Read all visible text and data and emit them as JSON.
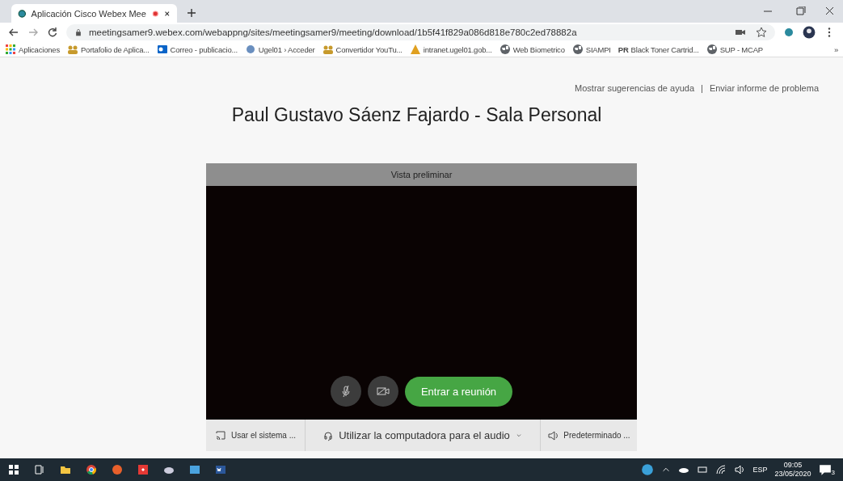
{
  "browser": {
    "tab": {
      "title": "Aplicación Cisco Webex Mee",
      "selected": true
    },
    "url": "meetingsamer9.webex.com/webappng/sites/meetingsamer9/meeting/download/1b5f41f829a086d818e780c2ed78882a",
    "bookmarks": [
      {
        "label": "Aplicaciones",
        "kind": "apps"
      },
      {
        "label": "Portafolio de Aplica...",
        "kind": "people"
      },
      {
        "label": "Correo - publicacio...",
        "kind": "mail"
      },
      {
        "label": "Ugel01 › Acceder",
        "kind": "sphere"
      },
      {
        "label": "Convertidor YouTu...",
        "kind": "people"
      },
      {
        "label": "intranet.ugel01.gob...",
        "kind": "pyramid"
      },
      {
        "label": "Web Biometrico",
        "kind": "globe"
      },
      {
        "label": "SIAMPI",
        "kind": "globe"
      },
      {
        "label": "Black Toner Cartrid...",
        "kind": "text",
        "mark": "PR"
      },
      {
        "label": "SUP - MCAP",
        "kind": "globe"
      }
    ],
    "more": "»"
  },
  "help_links": [
    "Mostrar sugerencias de ayuda",
    "Enviar informe de problema"
  ],
  "separator": "|",
  "title": "Paul Gustavo Sáenz Fajardo - Sala Personal",
  "preview": {
    "label": "Vista preliminar",
    "mic_muted": true,
    "camera_off": true,
    "join_button": "Entrar a reunión"
  },
  "audio_bar": {
    "system": "Usar el sistema ...",
    "audio": "Utilizar la computadora para el audio",
    "speaker": "Predeterminado ..."
  },
  "taskbar": {
    "language": "ESP",
    "time": "09:05",
    "date": "23/05/2020",
    "notifications": "3"
  }
}
